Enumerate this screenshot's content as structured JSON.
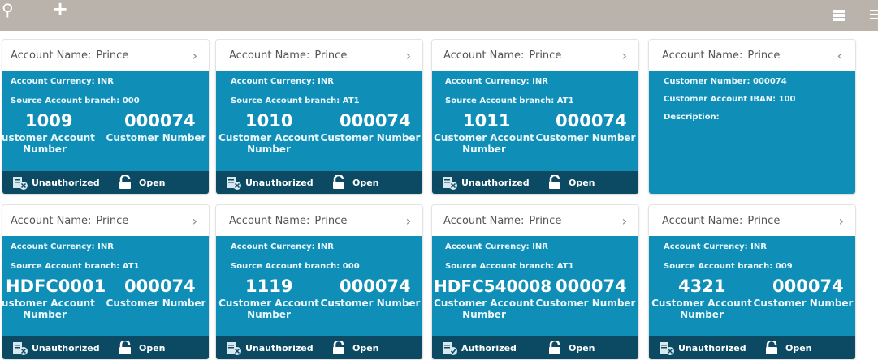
{
  "toolbar": {
    "search_icon": "search-icon",
    "add_label": "+",
    "grid_icon": "grid-icon",
    "menu_icon": "menu-icon"
  },
  "labels": {
    "account_name": "Account Name:",
    "account_currency": "Account Currency:",
    "source_branch": "Source Account branch:",
    "customer_account_number": "Customer Account Number",
    "customer_number_caption": "Customer Number",
    "open": "Open",
    "customer_number": "Customer Number:",
    "customer_account_iban": "Customer Account IBAN:",
    "description": "Description:"
  },
  "colors": {
    "card_body": "#0f8fb8",
    "card_footer": "#0b4a62",
    "toolbar": "#b9b3ac"
  },
  "cards": [
    {
      "name": "Prince",
      "currency": "INR",
      "branch": "000",
      "account_number": "1009",
      "customer_number": "000074",
      "auth_status": "Unauthorized",
      "state": "Open"
    },
    {
      "name": "Prince",
      "currency": "INR",
      "branch": "AT1",
      "account_number": "1010",
      "customer_number": "000074",
      "auth_status": "Unauthorized",
      "state": "Open"
    },
    {
      "name": "Prince",
      "currency": "INR",
      "branch": "AT1",
      "account_number": "1011",
      "customer_number": "000074",
      "auth_status": "Unauthorized",
      "state": "Open"
    },
    {
      "name": "Prince",
      "customer_number": "000074",
      "iban": "100",
      "description": "",
      "expanded": true
    },
    {
      "name": "Prince",
      "currency": "INR",
      "branch": "AT1",
      "account_number": "HDFC0001",
      "customer_number": "000074",
      "auth_status": "Unauthorized",
      "state": "Open"
    },
    {
      "name": "Prince",
      "currency": "INR",
      "branch": "000",
      "account_number": "1119",
      "customer_number": "000074",
      "auth_status": "Unauthorized",
      "state": "Open"
    },
    {
      "name": "Prince",
      "currency": "INR",
      "branch": "AT1",
      "account_number": "HDFC540008",
      "customer_number": "000074",
      "auth_status": "Authorized",
      "state": "Open"
    },
    {
      "name": "Prince",
      "currency": "INR",
      "branch": "009",
      "account_number": "4321",
      "customer_number": "000074",
      "auth_status": "Unauthorized",
      "state": "Open"
    }
  ]
}
